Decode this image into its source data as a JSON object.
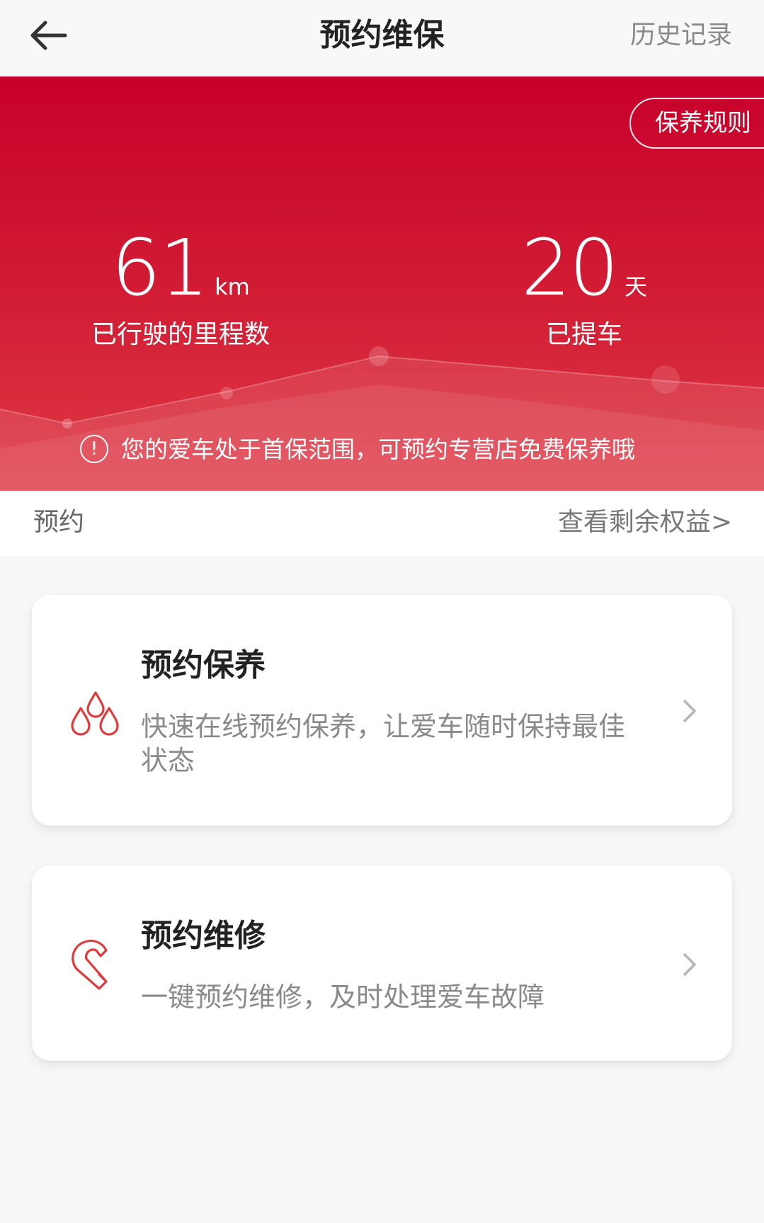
{
  "header": {
    "title": "预约维保",
    "history_label": "历史记录",
    "back_icon": "arrow-left-icon"
  },
  "hero": {
    "rules_label": "保养规则",
    "mileage": {
      "value": "61",
      "unit": "km",
      "label": "已行驶的里程数"
    },
    "days": {
      "value": "20",
      "unit": "天",
      "label": "已提车"
    },
    "notice_text": "您的爱车处于首保范围，可预约专营店免费保养哦",
    "notice_icon": "exclamation-circle-icon",
    "colors": {
      "primary": "#c8002a",
      "accent": "#e23b3f"
    }
  },
  "section": {
    "label": "预约",
    "benefits_label": "查看剩余权益>"
  },
  "cards": [
    {
      "title": "预约保养",
      "desc": "快速在线预约保养，让爱车随时保持最佳状态",
      "icon": "oil-drops-icon"
    },
    {
      "title": "预约维修",
      "desc": "一键预约维修，及时处理爱车故障",
      "icon": "wrench-icon"
    }
  ]
}
